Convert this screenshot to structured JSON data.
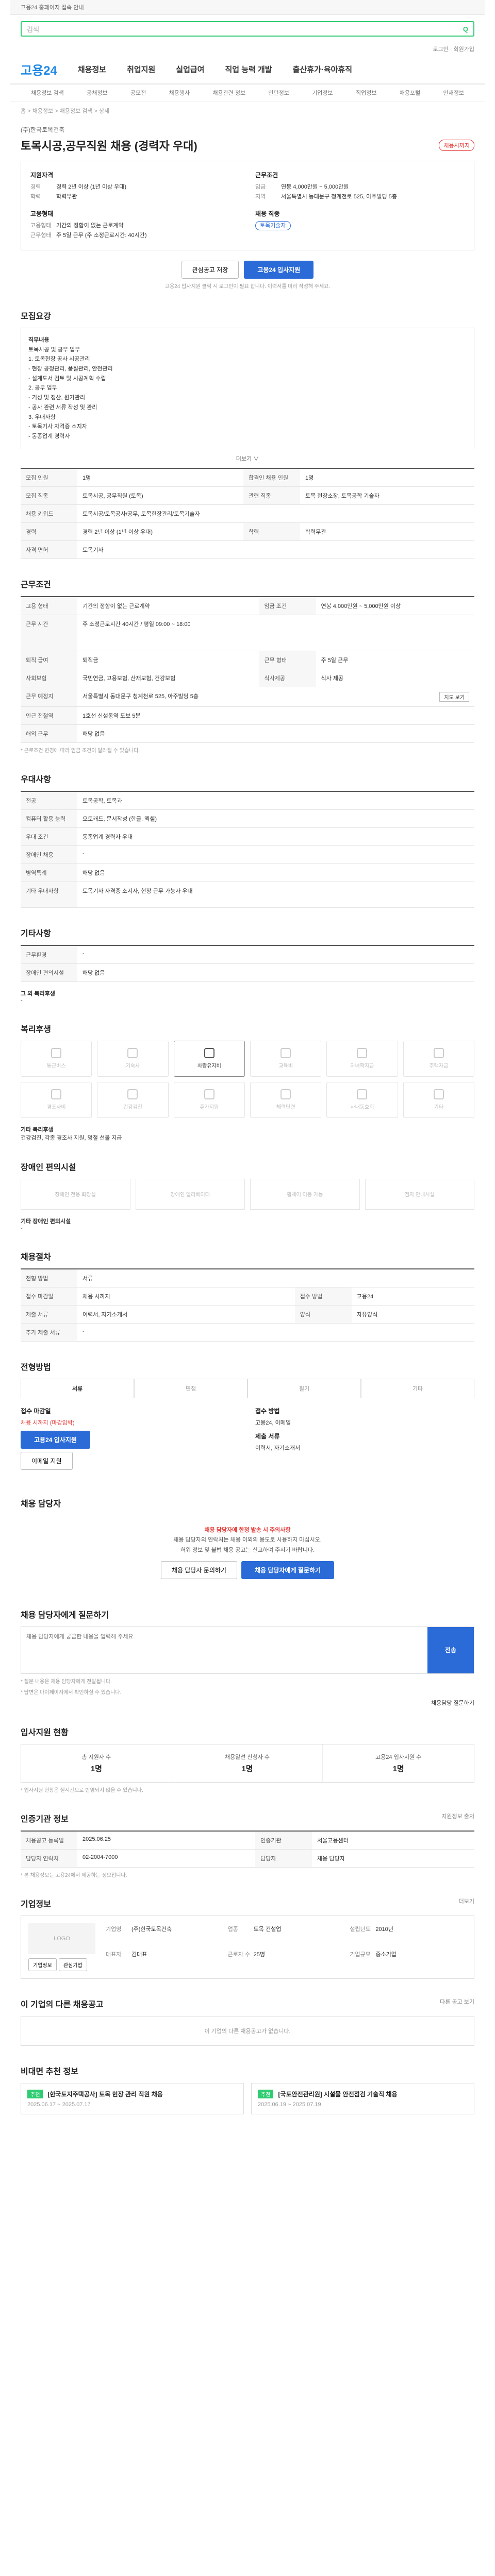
{
  "topbar": {
    "notice": "고용24 홈페이지 접속 안내"
  },
  "search": {
    "placeholder": "검색",
    "button": "Q"
  },
  "header": {
    "logo": "고용24",
    "util": "로그인 · 회원가입"
  },
  "gnb": [
    "채용정보",
    "취업지원",
    "실업급여",
    "직업 능력 개발",
    "출산휴가·육아휴직"
  ],
  "subgnb": [
    "채용정보 검색",
    "공채정보",
    "공모전",
    "채용행사",
    "채용관련 정보",
    "인턴정보",
    "기업정보",
    "직업정보",
    "채용포털",
    "인재정보"
  ],
  "breadcrumb": "홈 > 채용정보 > 채용정보 검색 > 상세",
  "job": {
    "company": "(주)한국토목건축",
    "title": "토목시공,공무직원 채용 (경력자 우대)",
    "badge": "채용시까지",
    "left_title": "지원자격",
    "left": [
      {
        "k": "경력",
        "v": "경력 2년 이상 (1년 이상 우대)"
      },
      {
        "k": "학력",
        "v": "학력무관"
      }
    ],
    "left2_title": "고용형태",
    "left2": [
      {
        "k": "고용형태",
        "v": "기간의 정함이 없는 근로계약"
      },
      {
        "k": "근무형태",
        "v": "주 5일 근무 (주 소정근로시간: 40시간)"
      }
    ],
    "right_title": "근무조건",
    "right": [
      {
        "k": "임금",
        "v": "연봉 4,000만원 ~ 5,000만원"
      },
      {
        "k": "지역",
        "v": "서울특별시 동대문구 청계천로 525, 아주빌딩 5층"
      }
    ],
    "right2_title": "채용 직종",
    "right2_badge": "토목기술자",
    "save_button": "관심공고 저장",
    "apply_button": "고용24 입사지원",
    "apply_note": "고용24 입사지원 클릭 시 로그인이 필요 합니다. 이력서를 미리 작성해 주세요."
  },
  "duty": {
    "heading": "모집요강",
    "box_title": "직무내용",
    "lines": [
      "토목시공 및 공무 업무",
      "1. 토목현장 공사 시공관리",
      " - 현장 공정관리, 품질관리, 안전관리",
      " - 설계도서 검토 및 시공계획 수립",
      "2. 공무 업무",
      " - 기성 및 정산, 원가관리",
      " - 공사 관련 서류 작성 및 관리",
      "3. 우대사항",
      " - 토목기사 자격증 소지자",
      " - 동종업계 경력자"
    ],
    "more": "더보기 ∨",
    "rows": [
      {
        "k": "모집 인원",
        "v": "1명",
        "k2": "합격인 채용 인원",
        "v2": "1명"
      },
      {
        "k": "모집 직종",
        "v": "토목시공, 공무직원 (토목)",
        "k2": "관련 직종",
        "v2": "토목 현장소장, 토목공학 기술자"
      },
      {
        "k": "채용 키워드",
        "v": "토목시공/토목공사/공무, 토목현장관리/토목기술자",
        "k2": "",
        "v2": ""
      },
      {
        "k": "경력",
        "v": "경력 2년 이상 (1년 이상 우대)",
        "k2": "학력",
        "v2": "학력무관"
      },
      {
        "k": "자격 면허",
        "v": "토목기사",
        "k2": "",
        "v2": ""
      }
    ]
  },
  "workcond": {
    "heading": "근무조건",
    "rows": [
      {
        "k": "고용 형태",
        "v": "기간의 정함이 없는 근로계약",
        "k2": "임금 조건",
        "v2": "연봉 4,000만원 ~ 5,000만원 이상"
      },
      {
        "k": "근무 시간",
        "v": "주 소정근로시간 40시간 / 평일 09:00 ~ 18:00",
        "k2": "",
        "v2": ""
      },
      {
        "k": "퇴직 급여",
        "v": "퇴직금",
        "k2": "근무 형태",
        "v2": "주 5일 근무"
      },
      {
        "k": "사회보험",
        "v": "국민연금, 고용보험, 산재보험, 건강보험",
        "k2": "식사제공",
        "v2": "식사 제공"
      },
      {
        "k": "근무 예정지",
        "v": "서울특별시 동대문구 청계천로 525, 아주빌딩 5층",
        "k2": "",
        "v2": ""
      },
      {
        "k": "인근 전철역",
        "v": "1호선 신설동역 도보 5분",
        "k2": "",
        "v2": ""
      },
      {
        "k": "해외 근무",
        "v": "해당 없음",
        "k2": "",
        "v2": ""
      }
    ],
    "map_button": "지도 보기",
    "tiny": "* 근로조건 변경에 따라 임금 조건이 달라질 수 있습니다."
  },
  "prefer": {
    "heading": "우대사항",
    "rows": [
      {
        "k": "전공",
        "v": "토목공학, 토목과"
      },
      {
        "k": "컴퓨터 활용 능력",
        "v": "오토캐드, 문서작성 (한글, 엑셀)"
      },
      {
        "k": "우대 조건",
        "v": "동종업계 경력자 우대"
      },
      {
        "k": "장애인 채용",
        "v": "-"
      },
      {
        "k": "병역특례",
        "v": "해당 없음"
      },
      {
        "k": "기타 우대사항",
        "v": "토목기사 자격증 소지자, 현장 근무 가능자 우대"
      }
    ]
  },
  "extra": {
    "heading": "기타사항",
    "rows": [
      {
        "k": "근무환경",
        "v": "-"
      },
      {
        "k": "장애인 편의시설",
        "v": "해당 없음"
      }
    ],
    "sub": "그 외 복리후생",
    "sub_v": "-"
  },
  "welfare": {
    "heading": "복리후생",
    "items": [
      "통근버스",
      "기숙사",
      "차량유지비",
      "교육비",
      "자녀학자금",
      "주택자금",
      "경조사비",
      "건강검진",
      "휴가지원",
      "체력단련",
      "사내동호회",
      "기타"
    ],
    "active": 2,
    "sub": "기타 복리후생",
    "sub_v": "건강검진, 각종 경조사 지원, 명절 선물 지급"
  },
  "disabled": {
    "heading": "장애인 편의시설",
    "items": [
      "장애인 전용 화장실",
      "장애인 엘리베이터",
      "휠체어 이동 가능",
      "점자 안내시설"
    ],
    "sub": "기타 장애인 편의시설",
    "sub_v": "-"
  },
  "process": {
    "heading": "채용절차",
    "rows": [
      {
        "k": "전형 방법",
        "v": "서류",
        "k2": "",
        "v2": ""
      },
      {
        "k": "접수 마감일",
        "v": "채용 시까지",
        "k2": "접수 방법",
        "v2": "고용24"
      },
      {
        "k": "제출 서류",
        "v": "이력서, 자기소개서",
        "k2": "양식",
        "v2": "자유양식"
      },
      {
        "k": "추가 제출 서류",
        "v": "-",
        "k2": "",
        "v2": ""
      }
    ]
  },
  "apply": {
    "heading": "전형방법",
    "tabs": [
      "서류",
      "면접",
      "필기",
      "기타"
    ],
    "left_title": "접수 마감일",
    "left_v": "채용 시까지 (마감임박)",
    "left_btn1": "고용24 입사지원",
    "left_btn2": "이메일 지원",
    "right_title": "접수 방법",
    "right_v": "고용24, 이메일",
    "right_title2": "제출 서류",
    "right_v2": "이력서, 자기소개서"
  },
  "fraud": {
    "heading": "채용 담당자",
    "title": "채용 담당자에 한정 발송 시 주의사항",
    "lines": [
      "채용 담당자의 연락처는 채용 이외의 용도로 사용하지 마십시오.",
      "허위 정보 및 불법 채용 공고는 신고하여 주시기 바랍니다."
    ],
    "btn1": "채용 담당자 문의하기",
    "btn2": "채용 담당자에게 질문하기"
  },
  "qa": {
    "heading": "채용 담당자에게 질문하기",
    "placeholder": "채용 담당자에게 궁금한 내용을 입력해 주세요.",
    "send": "전송",
    "notes": [
      "* 질문 내용은 채용 담당자에게 전달됩니다.",
      "* 답변은 마이페이지에서 확인하실 수 있습니다."
    ],
    "more": "채용담당 질문하기"
  },
  "stats": {
    "heading": "입사지원 현황",
    "items": [
      {
        "label": "총 지원자 수",
        "value": "1명"
      },
      {
        "label": "채용알선 신청자 수",
        "value": "1명"
      },
      {
        "label": "고용24 입사지원 수",
        "value": "1명"
      }
    ],
    "tiny": "* 입사지원 현황은 실시간으로 반영되지 않을 수 있습니다."
  },
  "info": {
    "heading": "인증기관 정보",
    "right": "지원정보 출처",
    "rows": [
      {
        "k": "채용공고 등록일",
        "v": "2025.06.25",
        "k2": "인증기관",
        "v2": "서울고용센터"
      },
      {
        "k": "담당자 연락처",
        "v": "02-2004-7000",
        "k2": "담당자",
        "v2": "채용 담당자"
      }
    ],
    "tiny": "* 본 채용정보는 고용24에서 제공하는 정보입니다."
  },
  "corp": {
    "heading": "기업정보",
    "logo": "LOGO",
    "rows": [
      {
        "k": "기업명",
        "v": "(주)한국토목건축"
      },
      {
        "k": "업종",
        "v": "토목 건설업"
      },
      {
        "k": "설립년도",
        "v": "2010년"
      },
      {
        "k": "대표자",
        "v": "김대표"
      },
      {
        "k": "근로자 수",
        "v": "25명"
      },
      {
        "k": "기업규모",
        "v": "중소기업"
      }
    ],
    "btn1": "기업정보",
    "btn2": "관심기업",
    "more": "더보기"
  },
  "related": {
    "heading": "이 기업의 다른 채용공고",
    "empty": "이 기업의 다른 채용공고가 없습니다.",
    "more": "다른 공고 보기"
  },
  "news": {
    "heading": "비대면 추천 정보",
    "cards": [
      {
        "tag": "추천",
        "title": "[한국토지주택공사] 토목 현장 관리 직원 채용",
        "date": "2025.06.17 ~ 2025.07.17"
      },
      {
        "tag": "추천",
        "title": "[국토안전관리원] 시설물 안전점검 기술직 채용",
        "date": "2025.06.19 ~ 2025.07.19"
      }
    ]
  }
}
